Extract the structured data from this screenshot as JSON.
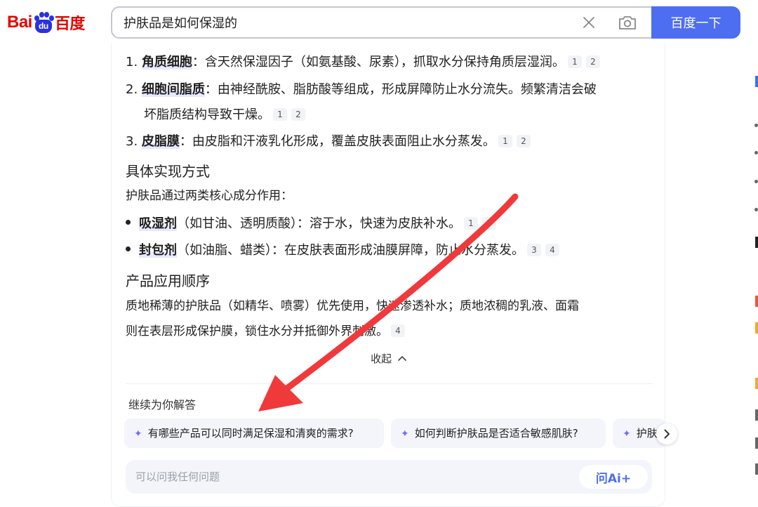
{
  "logo": {
    "text_bai": "Bai",
    "text_du": "du",
    "text_cn": "百度"
  },
  "search": {
    "query": "护肤品是如何保湿的",
    "button_label": "百度一下"
  },
  "answer": {
    "list1": [
      {
        "num": "1.",
        "keyword": "角质细胞",
        "text_l1": "：含天然保湿因子（如氨基酸、尿素），抓取水分保持角质层湿润。",
        "text_l2": "",
        "cites": [
          "1",
          "2"
        ]
      },
      {
        "num": "2.",
        "keyword": "细胞间脂质",
        "text_l1": "：由神经酰胺、脂肪酸等组成，形成屏障防止水分流失。频繁清洁会破",
        "text_l2": "坏脂质结构导致干燥。",
        "cites": [
          "1",
          "2"
        ]
      },
      {
        "num": "3.",
        "keyword": "皮脂膜",
        "text_l1": "：由皮脂和汗液乳化形成，覆盖皮肤表面阻止水分蒸发。",
        "text_l2": "",
        "cites": [
          "1",
          "2"
        ]
      }
    ],
    "heading_method": "具体实现方式",
    "method_intro": "护肤品通过两类核心成分作用：",
    "bullets": [
      {
        "keyword": "吸湿剂",
        "text": "（如甘油、透明质酸）：溶于水，快速为皮肤补水。",
        "cites": [
          "1",
          "3"
        ]
      },
      {
        "keyword": "封包剂",
        "text": "（如油脂、蜡类）：在皮肤表面形成油膜屏障，防止水分蒸发。",
        "cites": [
          "3",
          "4"
        ]
      }
    ],
    "heading_order": "产品应用顺序",
    "order_l1": "质地稀薄的护肤品（如精华、喷雾）优先使用，快速渗透补水；质地浓稠的乳液、面霜",
    "order_l2": "则在表层形成保护膜，锁住水分并抵御外界刺激。",
    "order_cites": [
      "4"
    ],
    "collapse_label": "收起"
  },
  "followup": {
    "label": "继续为你解答",
    "chips": [
      "有哪些产品可以同时满足保湿和清爽的需求?",
      "如何判断护肤品是否适合敏感肌肤?",
      "护肤"
    ]
  },
  "ask": {
    "placeholder": "可以问我任何问题",
    "button_label": "问Ai+"
  },
  "colors": {
    "brand_red": "#e10602",
    "brand_blue": "#2932e1",
    "search_button": "#4e6ef2",
    "annotation_arrow": "#f0393b",
    "chip_background": "#f3f5fa",
    "keyword_highlight": "#e6e9ff"
  },
  "icons": {
    "clear": "close-icon",
    "camera": "camera-icon",
    "spark": "sparkle-icon",
    "collapse": "chevron-up-icon",
    "next": "chevron-right-icon"
  }
}
